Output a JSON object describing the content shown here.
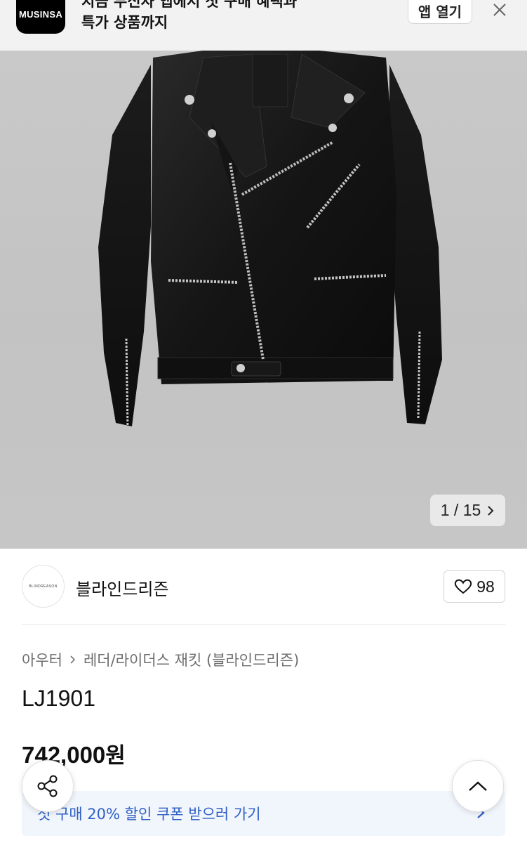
{
  "app_banner": {
    "logo_text": "MUSINSA",
    "line1": "지금 무신사 앱에서 첫 구매 혜택과",
    "line2": "특가 상품까지",
    "open_button": "앱 열기",
    "close_icon": "close-icon"
  },
  "gallery": {
    "current": "1",
    "separator": "/",
    "total": "15",
    "next_icon": "chevron-right-icon"
  },
  "brand": {
    "logo_text": "BLINDREASON",
    "name": "블라인드리즌",
    "likes": "98",
    "like_icon": "heart-outline-icon"
  },
  "breadcrumb": {
    "category": "아우터",
    "subcategory": "레더/라이더스 재킷 (블라인드리즌)"
  },
  "product": {
    "code": "LJ1901",
    "price": "742,000",
    "currency": "원"
  },
  "coupon": {
    "text": "첫 구매 20% 할인 쿠폰 받으러 가기"
  },
  "colors": {
    "coupon_text": "#2f5fc4",
    "coupon_bg": "#f1f5fc",
    "banner_bg": "#f2f2f2"
  }
}
